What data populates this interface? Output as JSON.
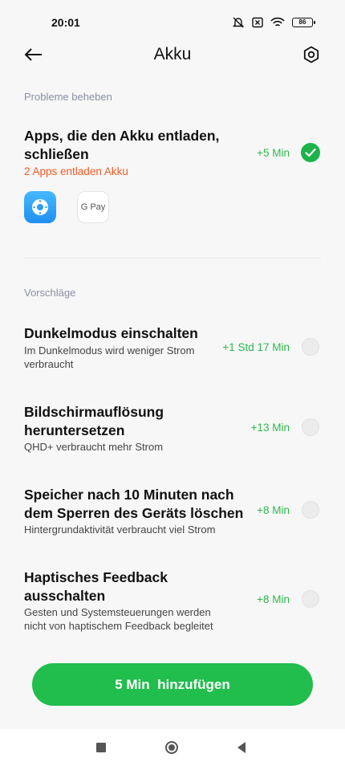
{
  "status": {
    "time": "20:01",
    "battery": "86",
    "icons": [
      "mute-icon",
      "sim-off-icon",
      "wifi-icon",
      "battery-icon"
    ]
  },
  "header": {
    "title": "Akku",
    "back_icon": "back-arrow-icon",
    "settings_icon": "gear-icon"
  },
  "problems": {
    "section_label": "Probleme beheben",
    "item": {
      "title_line1": "Apps, die den Akku entladen,",
      "title_line2": "schließen",
      "warning": "2 Apps entladen Akku",
      "gain": "+5 Min",
      "checked": true,
      "apps": [
        {
          "name": "blue-app-icon",
          "color": "#2a9df4"
        },
        {
          "name": "google-pay-icon",
          "label": "G Pay"
        }
      ]
    }
  },
  "suggestions": {
    "section_label": "Vorschläge",
    "items": [
      {
        "title_line1": "Dunkelmodus einschalten",
        "title_line2": "",
        "desc_line1": "Im Dunkelmodus wird weniger Strom",
        "desc_line2": "verbraucht",
        "gain": "+1 Std 17 Min",
        "checked": false
      },
      {
        "title_line1": "Bildschirmauflösung",
        "title_line2": "heruntersetzen",
        "desc_line1": "QHD+ verbraucht mehr Strom",
        "desc_line2": "",
        "gain": "+13 Min",
        "checked": false
      },
      {
        "title_line1": "Speicher nach 10 Minuten nach",
        "title_line2": "dem Sperren des Geräts löschen",
        "desc_line1": "Hintergrundaktivität verbraucht viel Strom",
        "desc_line2": "",
        "gain": "+8 Min",
        "checked": false
      },
      {
        "title_line1": "Haptisches Feedback",
        "title_line2": "ausschalten",
        "desc_line1": "Gesten und Systemsteuerungen werden",
        "desc_line2": "nicht von haptischem Feedback begleitet",
        "gain": "+8 Min",
        "checked": false
      }
    ]
  },
  "action": {
    "label": "5 Min  hinzufügen"
  },
  "colors": {
    "accent_green": "#21bd4d",
    "warning_orange": "#ef5a26",
    "section_gray": "#8a8fa3"
  }
}
